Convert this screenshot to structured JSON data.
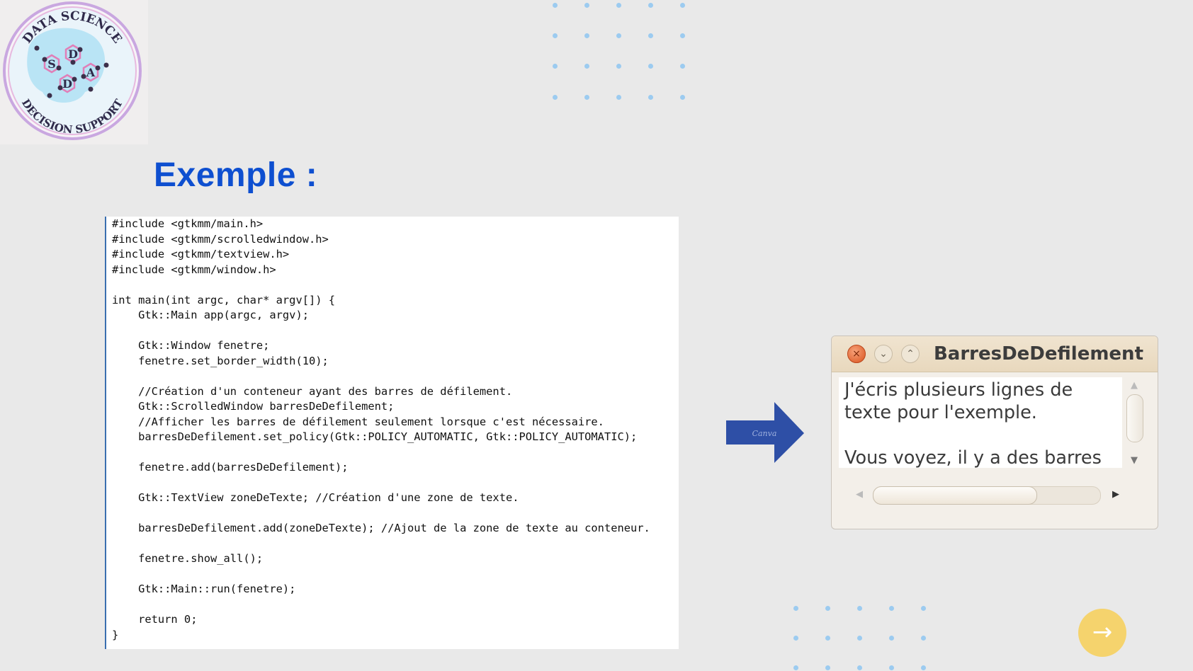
{
  "logo": {
    "top_text": "DATA SCIENCE",
    "bottom_text": "DECISION SUPPORT",
    "letters": [
      "S",
      "D",
      "D",
      "A"
    ]
  },
  "slide": {
    "title": "Exemple :"
  },
  "code": {
    "text": "#include <gtkmm/main.h>\n#include <gtkmm/scrolledwindow.h>\n#include <gtkmm/textview.h>\n#include <gtkmm/window.h>\n\nint main(int argc, char* argv[]) {\n    Gtk::Main app(argc, argv);\n\n    Gtk::Window fenetre;\n    fenetre.set_border_width(10);\n\n    //Création d'un conteneur ayant des barres de défilement.\n    Gtk::ScrolledWindow barresDeDefilement;\n    //Afficher les barres de défilement seulement lorsque c'est nécessaire.\n    barresDeDefilement.set_policy(Gtk::POLICY_AUTOMATIC, Gtk::POLICY_AUTOMATIC);\n\n    fenetre.add(barresDeDefilement);\n\n    Gtk::TextView zoneDeTexte; //Création d'une zone de texte.\n\n    barresDeDefilement.add(zoneDeTexte); //Ajout de la zone de texte au conteneur.\n\n    fenetre.show_all();\n\n    Gtk::Main::run(fenetre);\n\n    return 0;\n}"
  },
  "arrow": {
    "watermark": "Canva",
    "color": "#2e4fa6"
  },
  "window": {
    "title": "BarresDeDefilement",
    "text": "J'écris plusieurs lignes de texte pour l'exemple.\n\nVous voyez, il y a des barres de défilement!",
    "close_icon": "×",
    "minimize_icon": "⌄",
    "maximize_icon": "⌃"
  },
  "navigation": {
    "next_icon": "→",
    "color": "#f5d36d"
  },
  "colors": {
    "title": "#0e4fd0",
    "dots": "#9ccbf0",
    "background": "#e9e9e9"
  }
}
